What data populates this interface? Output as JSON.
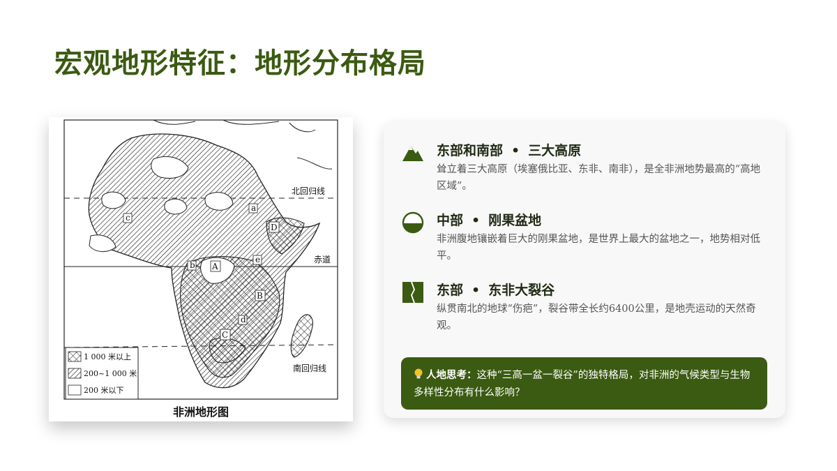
{
  "slide": {
    "title": "宏观地形特征：地形分布格局"
  },
  "map": {
    "caption": "非洲地形图",
    "labels": {
      "tropic_cancer": "北回归线",
      "equator": "赤道",
      "tropic_capricorn": "南回归线",
      "a": "a",
      "b": "b",
      "c": "c",
      "d": "d",
      "e": "e",
      "A": "A",
      "B": "B",
      "C": "C",
      "D": "D"
    },
    "legend": [
      {
        "label": "1 000 米以上"
      },
      {
        "label": "200~1 000 米"
      },
      {
        "label": "200 米以下"
      }
    ]
  },
  "features": [
    {
      "region": "东部和南部",
      "separator": "•",
      "name": "三大高原",
      "icon": "mountain-icon",
      "description": "耸立着三大高原（埃塞俄比亚、东非、南非），是全非洲地势最高的“高地区域”。"
    },
    {
      "region": "中部",
      "separator": "•",
      "name": "刚果盆地",
      "icon": "basin-icon",
      "description": "非洲腹地镶嵌着巨大的刚果盆地，是世界上最大的盆地之一，地势相对低平。"
    },
    {
      "region": "东部",
      "separator": "•",
      "name": "东非大裂谷",
      "icon": "rift-valley-icon",
      "description": "纵贯南北的地球“伤疤”，裂谷带全长约6400公里，是地壳运动的天然奇观。"
    }
  ],
  "callout": {
    "icon": "lightbulb-icon",
    "label": "人地思考：",
    "text": "这种“三高一盆一裂谷”的独特格局，对非洲的气候类型与生物多样性分布有什么影响？"
  },
  "colors": {
    "accent": "#3b5a12",
    "title": "#3b5a12",
    "body_text": "#555555"
  }
}
